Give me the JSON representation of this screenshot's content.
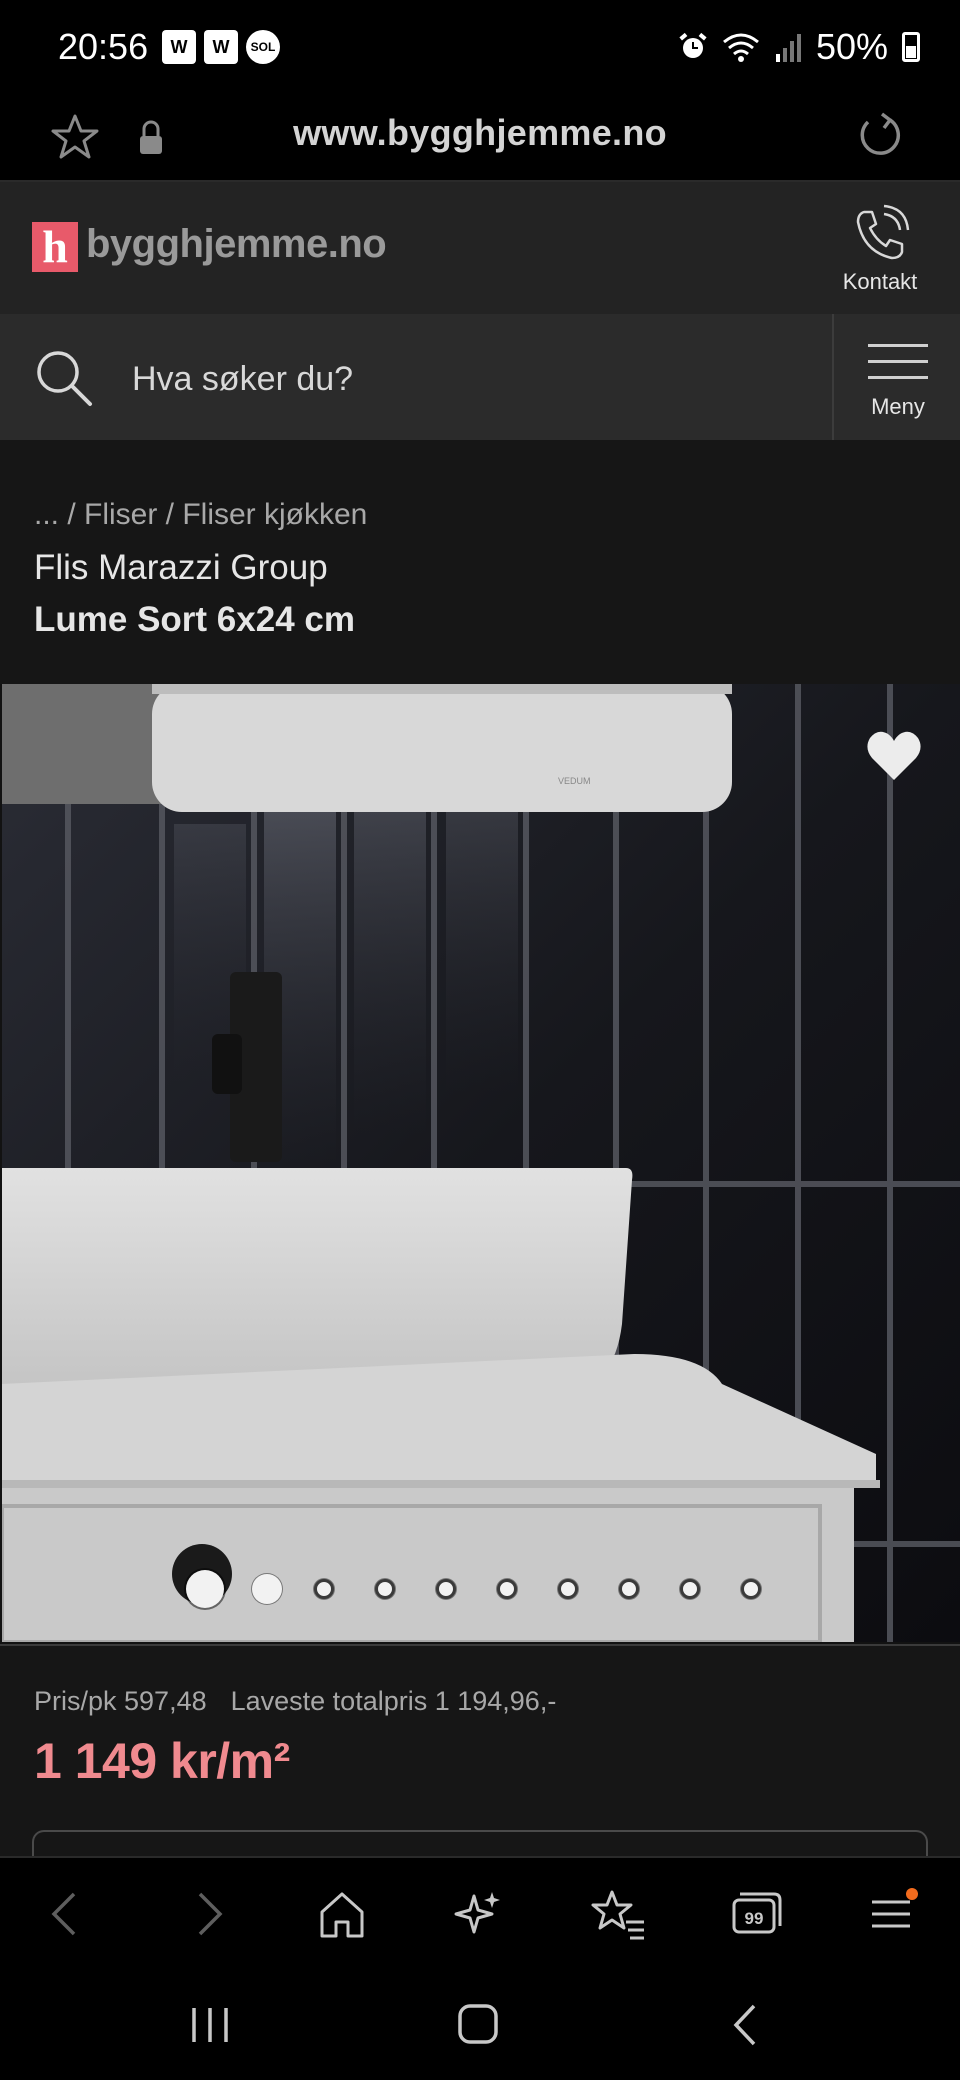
{
  "status_bar": {
    "time": "20:56",
    "badges": [
      "W",
      "W",
      "SOL"
    ],
    "battery": "50%"
  },
  "browser": {
    "url": "www.bygghjemme.no",
    "icons": [
      "star-outline-icon",
      "lock-icon",
      "reload-icon"
    ]
  },
  "header": {
    "logo_letter": "h",
    "logo_text": "bygghjemme.no",
    "contact_label": "Kontakt",
    "brand_color": "#e85a6a"
  },
  "search": {
    "placeholder": "Hva søker du?",
    "menu_label": "Meny"
  },
  "product": {
    "breadcrumb": "... / Fliser / Fliser kjøkken",
    "brand": "Flis Marazzi Group",
    "name": "Lume Sort 6x24 cm",
    "image_count": 10,
    "active_image": 1
  },
  "price": {
    "per_pack": "Pris/pk 597,48",
    "lowest_total": "Laveste totalpris 1 194,96,-",
    "main": "1 149 kr/m²",
    "price_color": "#f08a8f"
  },
  "bottom_toolbar": {
    "icons": [
      "back-icon",
      "forward-icon",
      "home-icon",
      "sparkle-icon",
      "bookmarks-icon",
      "tabs-icon",
      "menu-icon"
    ],
    "tabs_count": "99",
    "notification_color": "#f26b1d"
  },
  "system_nav": {
    "icons": [
      "recents-icon",
      "home-icon",
      "back-icon"
    ]
  }
}
